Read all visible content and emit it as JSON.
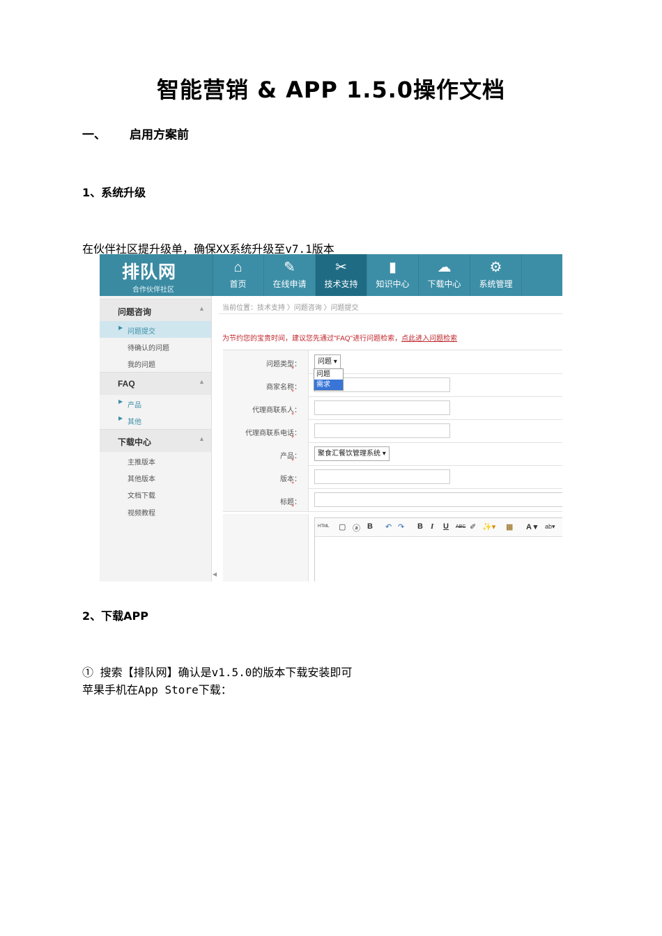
{
  "document": {
    "title": "智能营销 & APP 1.5.0操作文档",
    "section1": {
      "number": "一、",
      "title": "启用方案前"
    },
    "step1": {
      "heading": "1、系统升级",
      "text": "在伙伴社区提升级单，确保XX系统升级至v7.1版本"
    },
    "step2": {
      "heading": "2、下载APP",
      "line1": "① 搜索【排队网】确认是v1.5.0的版本下载安装即可",
      "line2": "苹果手机在App Store下载："
    }
  },
  "screenshot": {
    "logo": {
      "main": "排队网",
      "sub": "合作伙伴社区"
    },
    "nav": [
      {
        "label": "首页",
        "icon": "home-icon",
        "glyph": "⌂"
      },
      {
        "label": "在线申请",
        "icon": "edit-icon",
        "glyph": "✎"
      },
      {
        "label": "技术支持",
        "icon": "tools-icon",
        "glyph": "✂"
      },
      {
        "label": "知识中心",
        "icon": "book-icon",
        "glyph": "▮"
      },
      {
        "label": "下载中心",
        "icon": "cloud-icon",
        "glyph": "☁"
      },
      {
        "label": "系统管理",
        "icon": "gear-icon",
        "glyph": "⚙"
      }
    ],
    "active_nav": "技术支持",
    "sidebar": {
      "sections": [
        {
          "title": "问题咨询",
          "items": [
            "问题提交",
            "待确认的问题",
            "我的问题"
          ]
        },
        {
          "title": "FAQ",
          "items": [
            "产品",
            "其他"
          ]
        },
        {
          "title": "下载中心",
          "items": [
            "主推版本",
            "其他版本",
            "文档下载",
            "视频教程"
          ]
        }
      ]
    },
    "breadcrumb": "当前位置：技术支持 〉问题咨询 〉问题提交",
    "notice": {
      "text": "为节约您的宝贵时间，建议您先通过\"FAQ\"进行问题检索，",
      "link": "点此进入问题检索"
    },
    "form": {
      "question_type": {
        "label": "问题类型：",
        "value": "问题 ▾",
        "options": [
          "问题",
          "需求"
        ],
        "highlighted": "需求"
      },
      "merchant_name": {
        "label": "商家名称："
      },
      "agent_contact": {
        "label": "代理商联系人："
      },
      "agent_phone": {
        "label": "代理商联系电话："
      },
      "product": {
        "label": "产品：",
        "value": "聚食汇餐饮管理系统 ▾"
      },
      "version": {
        "label": "版本："
      },
      "subject": {
        "label": "标题："
      },
      "required_mark": "*"
    },
    "editor_toolbar": [
      "HTML",
      "▢",
      "ⓐ",
      "B",
      "↶",
      "↷",
      "B",
      "I",
      "U",
      "ABC",
      "✐",
      "✨▾",
      "▦",
      "A ▾",
      "ab▾"
    ],
    "colors": {
      "topbar": "#3c8ea7",
      "active_nav": "#1f6b84",
      "notice": "#c0272d",
      "accent": "#3c8ea7"
    }
  }
}
